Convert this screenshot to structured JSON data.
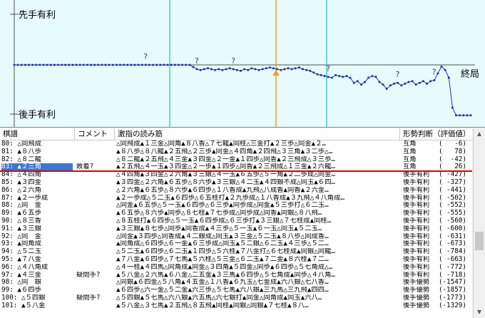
{
  "graph": {
    "top_label": "先手有利",
    "bottom_label": "後手有利",
    "end_label": "終局",
    "question_mark": "?",
    "colors": {
      "line": "#1f2fb8",
      "cursor": "#f0a020",
      "grid": "#00b0b0",
      "axis": "#505050",
      "background": "#e8fbfc"
    },
    "evaluation_curve": [
      0,
      0,
      0,
      0,
      0,
      0,
      0,
      0,
      0,
      0,
      0,
      0,
      0,
      0,
      0,
      0,
      0,
      0,
      0,
      0,
      0,
      0,
      0,
      0,
      0,
      0,
      0,
      0,
      0,
      0,
      0,
      0,
      0,
      0,
      0,
      0,
      0,
      0,
      0,
      0,
      0,
      0,
      0,
      0,
      0,
      0,
      0,
      0,
      0,
      -5,
      -10,
      -12,
      -10,
      -8,
      -10,
      -12,
      -10,
      -12,
      -10,
      -8,
      -10,
      -12,
      -14,
      -10,
      -12,
      -8,
      -10,
      -12,
      -10,
      -8,
      -6,
      -8,
      -10,
      -12,
      -10,
      -8,
      -10,
      -8,
      -6,
      -10,
      -12,
      -14,
      -18,
      -22,
      -24,
      -26,
      -28,
      -30,
      -24,
      -26,
      -28,
      -26,
      -30,
      -42,
      -38,
      -46,
      -40,
      -30,
      -26,
      -28,
      -40,
      -46,
      -56,
      -48,
      -44,
      -42,
      -48,
      -44,
      -40,
      -38,
      -46,
      -42,
      -38,
      -44,
      -38,
      -36,
      -20,
      -4,
      -12,
      -30,
      -100,
      -118,
      -118,
      -118,
      -118,
      -118
    ],
    "question_indices": [
      36,
      50,
      60,
      86,
      105,
      115
    ]
  },
  "table": {
    "headers": [
      "棋譜",
      "コメント",
      "激指の読み筋",
      "形勢判断（評価値）"
    ],
    "rows": [
      {
        "move": "80: △同飛成",
        "comment": "",
        "pv": "△同飛成▲１三金△同角▲８八香△７七龍▲同桂△三金打▲２三歩△同金▲２…",
        "judge": "互角",
        "score": "-6"
      },
      {
        "move": "81: ▲８八歩",
        "comment": "",
        "pv": "▲８八歩△８八龍▲２五飛△２三歩▲同金△４四角▲２四飛△３三角▲３二歩△…",
        "judge": "互角",
        "score": "78"
      },
      {
        "move": "82: △８二龍",
        "comment": "",
        "pv": "△８二龍▲２五飛△４三金▲３四金△２一金▲１四歩△同香▲２三飛成△３三歩…",
        "judge": "互角",
        "score": "-42"
      },
      {
        "move": "83: ▲２三角",
        "comment": "敗着?",
        "pv": "▲２五飛△４一玉▲３四金△２一歩▲１四歩△同香▲２三飛成△１三金▲２六龍…",
        "judge": "互角",
        "score": "26"
      },
      {
        "move": "84: △４四角",
        "comment": "",
        "pv": "△４四角▲３四金△２六角▲３三銀△４一玉▲６五歩△５一角▲２二歩成△同金…",
        "judge": "後手有利",
        "score": "-427"
      },
      {
        "move": "85: ▲３四金",
        "comment": "",
        "pv": "▲３四金△２六角▲６五歩△８六歩▲３三銀△４二玉▲４四銀不成△同玉▲６四…",
        "judge": "後手有利",
        "score": "-327"
      },
      {
        "move": "86: △２六角",
        "comment": "",
        "pv": "△２六角▲６五歩△８六歩▲６四歩△１八香成▲九飛△八成香▲同香▲２六金…",
        "judge": "後手有利",
        "score": "-441"
      },
      {
        "move": "87: ▲２一歩成",
        "comment": "",
        "pv": "▲２一歩成△５二玉▲６四歩△６五桂打▲２九歩成△１八香成▲３九飛△４八角成…",
        "judge": "後手有利",
        "score": "-502"
      },
      {
        "move": "88: △同　金",
        "comment": "",
        "pv": "△同金▲６五歩△５一玉▲６四歩△６三歩▲同歩成△同金▲５三歩打△６二玉…",
        "judge": "後手有利",
        "score": "-552"
      },
      {
        "move": "89: ▲６五歩",
        "comment": "",
        "pv": "▲６五歩△８六歩▲同歩△８七桂▲７七歩成△同歩成△同香▲同銀△８八飛…",
        "judge": "後手有利",
        "score": "-555"
      },
      {
        "move": "90: △８三香",
        "comment": "",
        "pv": "△８五桂打▲６四歩△５一玉▲６四歩成△６三歩打▲３三銀△７七桂成▲同桂…",
        "judge": "後手有利",
        "score": "-560"
      },
      {
        "move": "91: ▲３三銀",
        "comment": "",
        "pv": "▲３三銀▲８七歩△同歩▲同香成▲４三歩△５一玉▲６一玉△同玉▲５二玉…",
        "judge": "後手有利",
        "score": "-600"
      },
      {
        "move": "92: △同　金",
        "comment": "",
        "pv": "△同金▲３四歩△同香成▲４二銀成△同玉▲３三金△５二玉▲８八歩△同成香…",
        "judge": "後手有利",
        "score": "-631"
      },
      {
        "move": "93: ▲同角成",
        "comment": "",
        "pv": "▲同角成△６四歩△６一金▲６三歩成△同玉▲５二銀△６二玉▲４三歩△５二…",
        "judge": "後手有利",
        "score": "-673"
      },
      {
        "move": "94: △５二玉",
        "comment": "",
        "pv": "△５二玉▲６四歩△６二玉▲１四歩△５六桂▲７八金打△６七桂成▲同銀△同龍…",
        "judge": "後手有利",
        "score": "-784"
      },
      {
        "move": "95: ▲７八金",
        "comment": "",
        "pv": "▲７八金▲６四歩△７七馬▲５六桂△５三金△６二玉▲７二金▲８六桂▲７二…",
        "judge": "後手有利",
        "score": "-663"
      },
      {
        "move": "96: △４八角成",
        "comment": "",
        "pv": "△４一桂▲４四馬△同角成▲同金△３四角▲５四金△同歩▲６四歩△５七角成△…",
        "judge": "後手有利",
        "score": "-772"
      },
      {
        "move": "97: ▲４三金",
        "comment": "疑問手?",
        "pv": "▲５八金△２六馬▲６八金△二五金▲３三馬▲６四歩△５七角成▲同歩△４八角…",
        "judge": "後手有利",
        "score": "-718"
      },
      {
        "move": "98: △同　銀",
        "comment": "",
        "pv": "△同銀▲６四金△５八角▲４五金△１八香▲６九玉△七金成▲六八銀△七八香…",
        "judge": "後手優勢",
        "score": "-1547"
      },
      {
        "move": "99: ▲６四歩",
        "comment": "",
        "pv": "▲６四歩△六一金△５二金▲六三歩△５七馬▲六八銀▲三九馬△三九飛▲四四…",
        "judge": "後手優勢",
        "score": "-1857"
      },
      {
        "move": "100: △５四銀",
        "comment": "疑問手?",
        "pv": "△５四銀▲５七馬△六八銀▲六五馬△六七銀打▲同金△同角成▲同玉▲六八…",
        "judge": "後手優勢",
        "score": "-1773"
      },
      {
        "move": "101: ▲５八金",
        "comment": "",
        "pv": "▲５八金△３七馬▲２五飛△８五飛▲同桂▲同銀△同銀▲７七桂▲８八…",
        "judge": "後手優勢",
        "score": "-1329"
      }
    ],
    "selected_index": 3
  },
  "scrollbar": {
    "up_icon": "▲",
    "down_icon": "▼"
  }
}
